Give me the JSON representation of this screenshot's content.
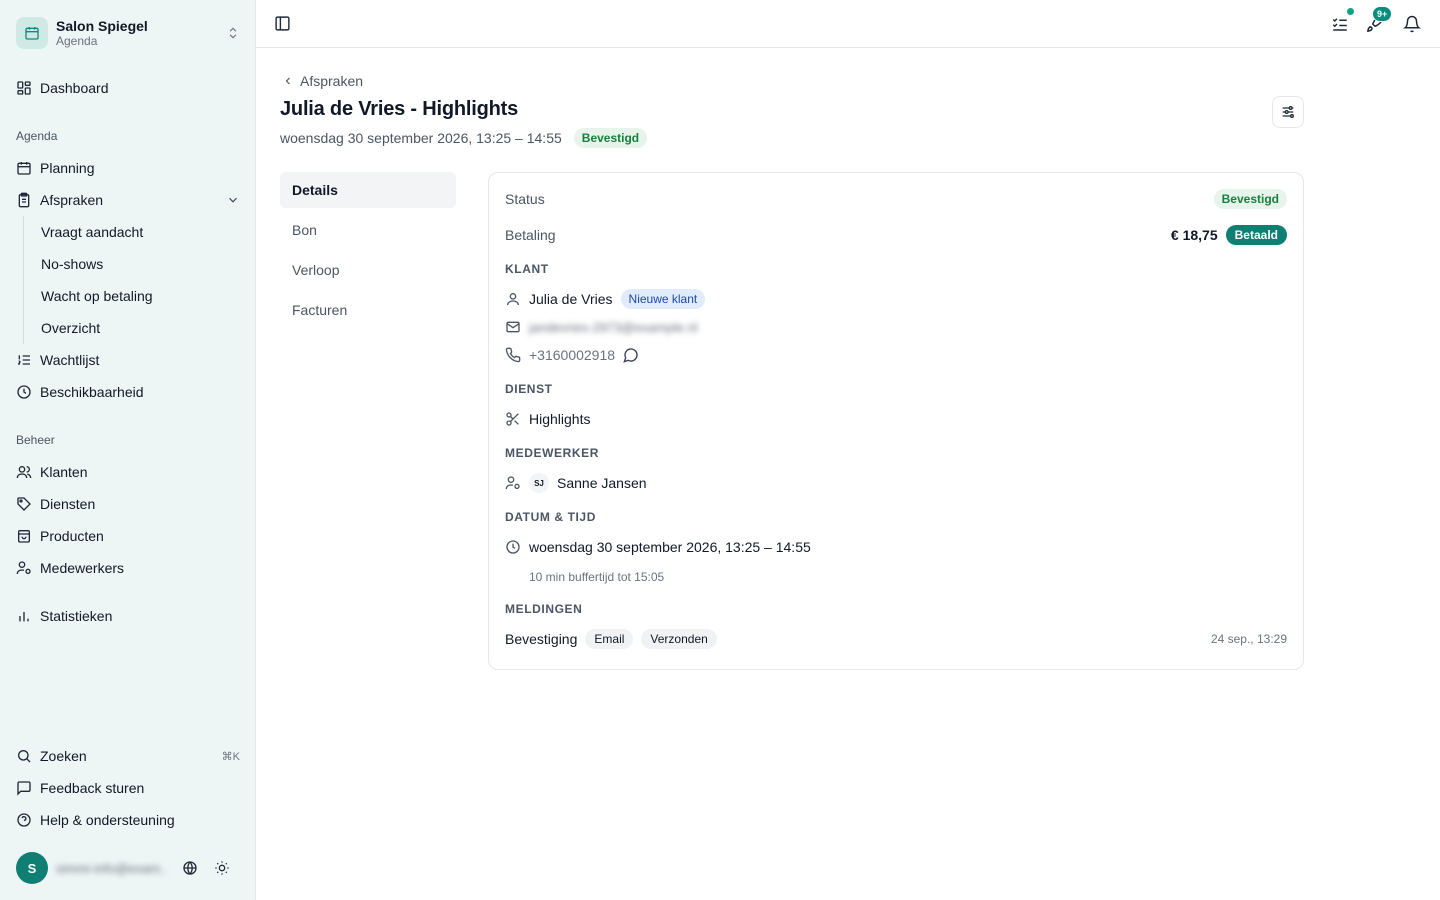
{
  "sidebar": {
    "brand": {
      "title": "Salon Spiegel",
      "subtitle": "Agenda"
    },
    "dashboard": "Dashboard",
    "group_agenda": "Agenda",
    "planning": "Planning",
    "afspraken": "Afspraken",
    "sub_items": [
      "Vraagt aandacht",
      "No-shows",
      "Wacht op betaling",
      "Overzicht"
    ],
    "wachtlijst": "Wachtlijst",
    "beschikbaarheid": "Beschikbaarheid",
    "group_beheer": "Beheer",
    "klanten": "Klanten",
    "diensten": "Diensten",
    "producten": "Producten",
    "medewerkers": "Medewerkers",
    "statistieken": "Statistieken",
    "zoeken": "Zoeken",
    "zoeken_shortcut": "⌘K",
    "feedback": "Feedback sturen",
    "help": "Help & ondersteuning",
    "user_initial": "S",
    "user_email": "simmi-info@exam..."
  },
  "topbar": {
    "notifications_badge": "9+"
  },
  "header": {
    "breadcrumb": "Afspraken",
    "title": "Julia de Vries - Highlights",
    "datetime": "woensdag 30 september 2026, 13:25 – 14:55",
    "status": "Bevestigd"
  },
  "tabs": [
    "Details",
    "Bon",
    "Verloop",
    "Facturen"
  ],
  "details": {
    "status_label": "Status",
    "status_value": "Bevestigd",
    "payment_label": "Betaling",
    "payment_amount": "€ 18,75",
    "payment_status": "Betaald",
    "klant_heading": "KLANT",
    "client_name": "Julia de Vries",
    "client_badge": "Nieuwe klant",
    "client_email": "jandevries-2973@example.nl",
    "client_phone": "+3160002918",
    "dienst_heading": "DIENST",
    "service": "Highlights",
    "medewerker_heading": "MEDEWERKER",
    "employee_initials": "SJ",
    "employee_name": "Sanne Jansen",
    "datum_heading": "DATUM & TIJD",
    "appointment_datetime": "woensdag 30 september 2026, 13:25 – 14:55",
    "buffer_note": "10 min buffertijd tot 15:05",
    "meldingen_heading": "MELDINGEN",
    "notification_type": "Bevestiging",
    "notification_channel": "Email",
    "notification_status": "Verzonden",
    "notification_time": "24 sep., 13:29"
  }
}
